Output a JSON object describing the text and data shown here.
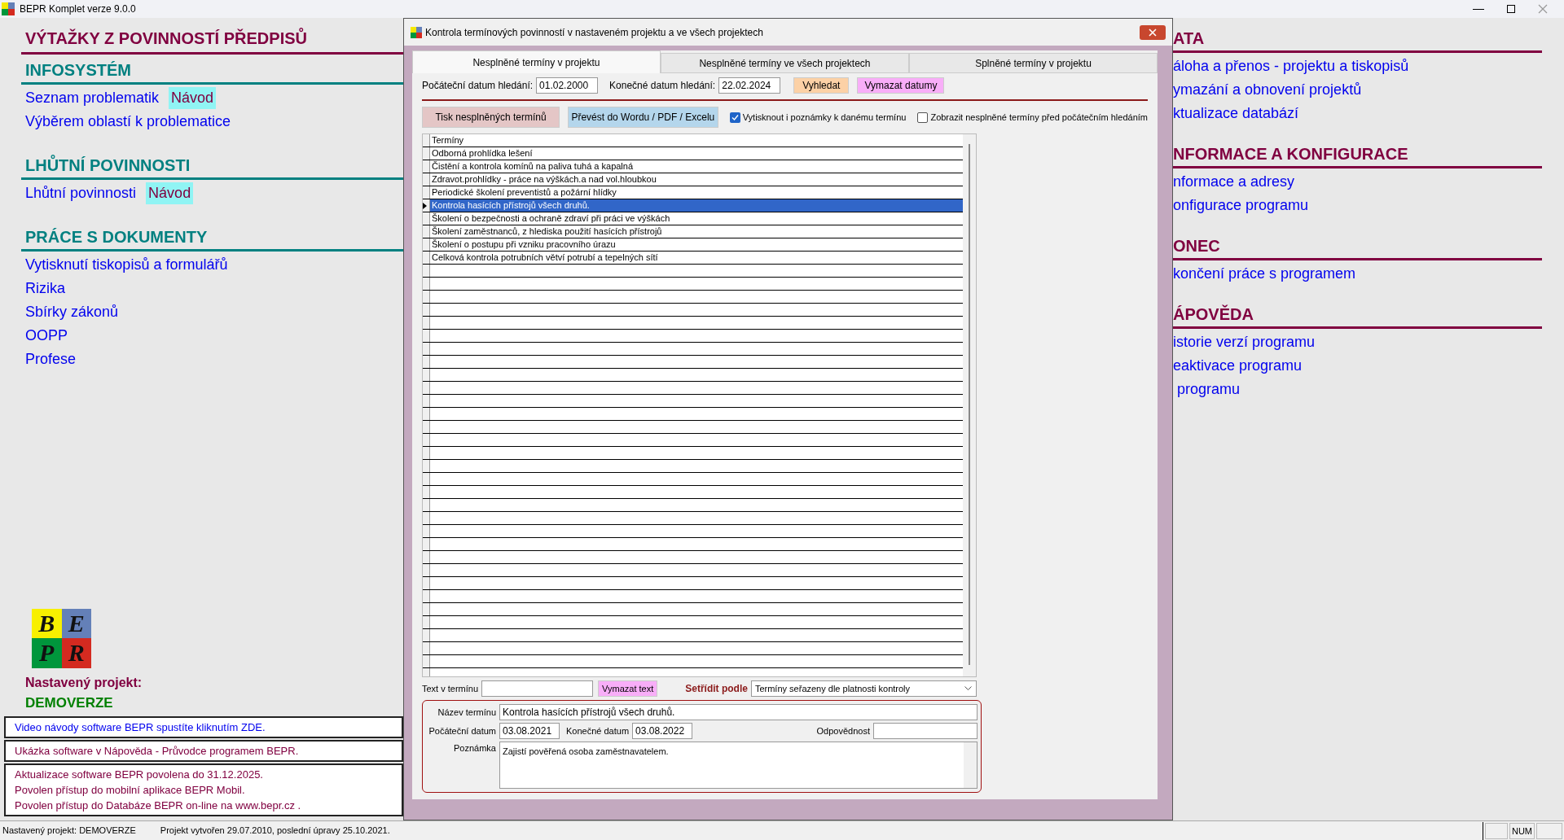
{
  "app_title": "BEPR Komplet verze 9.0.0",
  "left_panel": {
    "title": "VÝTAŽKY Z POVINNOSTÍ PŘEDPISŮ",
    "sections": [
      {
        "heading": "INFOSYSTÉM",
        "items": [
          {
            "label": "Seznam problematik",
            "guide": "Návod"
          },
          {
            "label": "Výběrem oblastí k problematice"
          }
        ]
      },
      {
        "heading": "LHŮTNÍ POVINNOSTI",
        "items": [
          {
            "label": "Lhůtní povinnosti",
            "guide": "Návod"
          }
        ]
      },
      {
        "heading": "PRÁCE S DOKUMENTY",
        "items": [
          {
            "label": "Vytisknutí tiskopisů a formulářů"
          },
          {
            "label": "Rizika"
          },
          {
            "label": "Sbírky zákonů"
          },
          {
            "label": "OOPP"
          },
          {
            "label": "Profese"
          }
        ]
      }
    ]
  },
  "logo_letters": [
    "B",
    "E",
    "P",
    "R"
  ],
  "project": {
    "label": "Nastavený projekt:",
    "name": "DEMOVERZE"
  },
  "notices": [
    {
      "kind": "link",
      "lines": [
        "Video návody software BEPR spustíte kliknutím ZDE."
      ]
    },
    {
      "kind": "info",
      "lines": [
        "Ukázka software v Nápověda - Průvodce programem BEPR."
      ]
    },
    {
      "kind": "info",
      "lines": [
        "Aktualizace software BEPR povolena do 31.12.2025.",
        "Povolen přístup do mobilní aplikace BEPR Mobil.",
        "Povolen přístup do Databáze BEPR on-line na www.bepr.cz ."
      ]
    }
  ],
  "dialog": {
    "title": "Kontrola termínových povinností v nastaveném projektu a ve všech projektech",
    "tabs": [
      {
        "label": "Nesplněné termíny v projektu",
        "selected": true
      },
      {
        "label": "Nesplněné termíny ve všech projektech",
        "selected": false
      },
      {
        "label": "Splněné termíny v projektu",
        "selected": false
      }
    ],
    "start_date": {
      "label": "Počáteční datum hledání:",
      "value": "01.02.2000"
    },
    "end_date": {
      "label": "Konečné datum hledání:",
      "value": "22.02.2024"
    },
    "search_button": "Vyhledat",
    "clear_dates_button": "Vymazat datumy",
    "print_button": "Tisk nesplněných termínů",
    "export_button": "Převést do Wordu / PDF / Excelu",
    "checkboxes": [
      {
        "label": "Vytisknout i poznámky k danému termínu",
        "checked": true
      },
      {
        "label": "Zobrazit nesplněné termíny před počátečním hledáním",
        "checked": false
      }
    ],
    "grid": {
      "header": "Termíny",
      "rows": [
        {
          "text": "Odborná prohlídka lešení",
          "selected": false
        },
        {
          "text": "Čistění a kontrola komínů na paliva tuhá a kapalná",
          "selected": false
        },
        {
          "text": "Zdravot.prohlídky - práce na výškách.a nad vol.hloubkou",
          "selected": false
        },
        {
          "text": "Periodické školení preventistů a požární hlídky",
          "selected": false
        },
        {
          "text": "Kontrola hasících přístrojů všech druhů.",
          "selected": true
        },
        {
          "text": "Školení o bezpečnosti a ochraně zdraví při práci ve výškách",
          "selected": false
        },
        {
          "text": "Školení zaměstnanců, z hlediska použití hasících přístrojů",
          "selected": false
        },
        {
          "text": "Školení o postupu při vzniku pracovního úrazu",
          "selected": false
        },
        {
          "text": "Celková kontrola potrubních větví potrubí a tepelných sítí",
          "selected": false
        }
      ]
    },
    "text_filter": {
      "label": "Text v termínu"
    },
    "clear_text_button": "Vymazat text",
    "sort": {
      "label": "Setřídit podle",
      "value": "Termíny seřazeny dle platnosti kontroly"
    },
    "detail": {
      "name_label": "Název termínu",
      "name": "Kontrola hasících přístrojů všech druhů.",
      "start_label": "Počáteční datum",
      "start": "03.08.2021",
      "end_label": "Konečné datum",
      "end": "03.08.2022",
      "responsibility_label": "Odpovědnost",
      "note_label": "Poznámka",
      "note": "Zajistí pověřená osoba zaměstnavatelem."
    }
  },
  "right_panel": {
    "sections": [
      {
        "heading": "ATA",
        "items": [
          "áloha a přenos - projektu a tiskopisů",
          "ymazání a obnovení projektů",
          "ktualizace databází"
        ]
      },
      {
        "heading": "NFORMACE A KONFIGURACE",
        "items": [
          "nformace a adresy",
          "onfigurace programu"
        ]
      },
      {
        "heading": "ONEC",
        "items": [
          "končení práce s programem"
        ]
      },
      {
        "heading": "ÁPOVĚDA",
        "items": [
          "istorie verzí programu",
          "eaktivace programu",
          " programu"
        ]
      }
    ]
  },
  "status_bar": {
    "project": "Nastavený projekt: DEMOVERZE",
    "info": "Projekt vytvořen 29.07.2010, poslední úpravy 25.10.2021.",
    "indicator": "NUM"
  }
}
